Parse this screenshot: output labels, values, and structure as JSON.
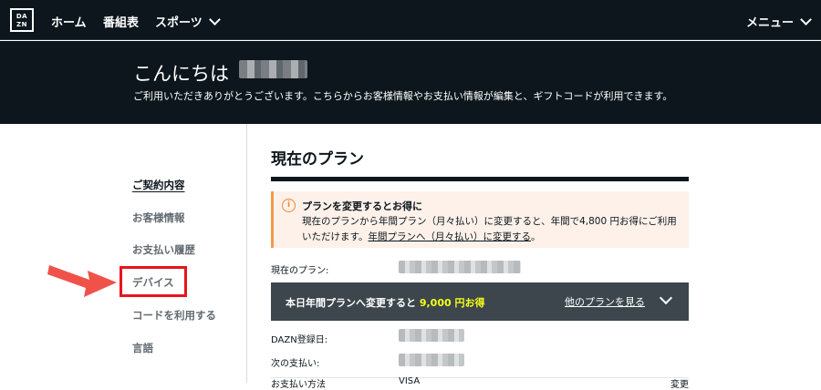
{
  "nav": {
    "logo_top": "DA",
    "logo_bottom": "ZN",
    "items": [
      {
        "label": "ホーム"
      },
      {
        "label": "番組表"
      },
      {
        "label": "スポーツ"
      }
    ],
    "menu_label": "メニュー"
  },
  "hero": {
    "greeting": "こんにちは",
    "subtitle": "ご利用いただきありがとうございます。こちらからお客様情報やお支払い情報が編集と、ギフトコードが利用できます。"
  },
  "sidebar": {
    "items": [
      {
        "label": "ご契約内容",
        "active": true
      },
      {
        "label": "お客様情報",
        "active": false
      },
      {
        "label": "お支払い履歴",
        "active": false
      },
      {
        "label": "デバイス",
        "active": false,
        "highlighted": true
      },
      {
        "label": "コードを利用する",
        "active": false
      },
      {
        "label": "言語",
        "active": false
      }
    ]
  },
  "main": {
    "title": "現在のプラン",
    "notice": {
      "title": "プランを変更するとお得に",
      "body": "現在のプランから年間プラン（月々払い）に変更すると、年間で4,800 円お得にご利用いただけます。",
      "link": "年間プランへ（月々払い）に変更する",
      "tail": "。"
    },
    "current_plan_label": "現在のプラン:",
    "upgrade": {
      "text": "本日年間プランへ変更すると ",
      "price": "9,000 円お得",
      "other_plans": "他のプランを見る"
    },
    "registered_label": "DAZN登録日:",
    "next_payment_label": "次の支払い:",
    "payment_method_partial": "お支払い方法",
    "card_partial": "VISA",
    "change_partial": "変更"
  },
  "colors": {
    "header_bg": "#0c161c",
    "accent_highlight": "#e8141c",
    "arrow": "#f0524a",
    "notice_bg": "#fdf1ea",
    "notice_accent": "#f0872d",
    "upgrade_bg": "#3c464c",
    "price_yellow": "#f7ff1a"
  }
}
